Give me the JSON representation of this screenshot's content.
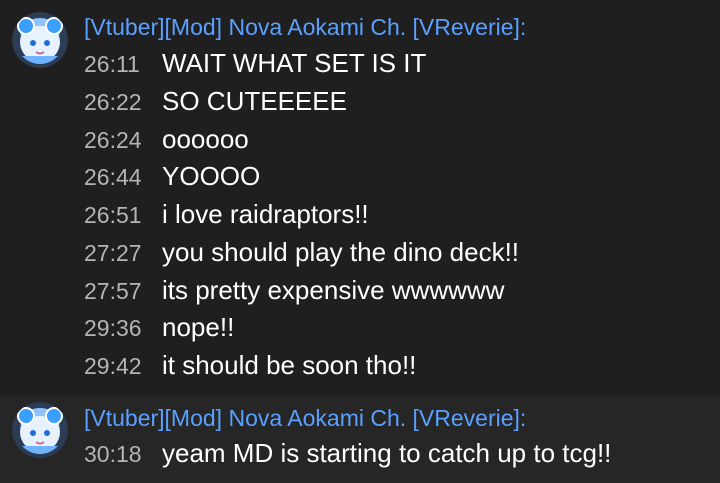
{
  "messages": [
    {
      "author": "[Vtuber][Mod] Nova Aokami Ch. [VReverie]:",
      "lines": [
        {
          "time": "26:11",
          "text": "WAIT WHAT SET IS IT"
        },
        {
          "time": "26:22",
          "text": "SO CUTEEEEE"
        },
        {
          "time": "26:24",
          "text": "oooooo"
        },
        {
          "time": "26:44",
          "text": "YOOOO"
        },
        {
          "time": "26:51",
          "text": "i love raidraptors!!"
        },
        {
          "time": "27:27",
          "text": "you should play the dino deck!!"
        },
        {
          "time": "27:57",
          "text": "its pretty expensive wwwwww"
        },
        {
          "time": "29:36",
          "text": "nope!!"
        },
        {
          "time": "29:42",
          "text": "it should be soon tho!!"
        }
      ]
    },
    {
      "author": "[Vtuber][Mod] Nova Aokami Ch. [VReverie]:",
      "lines": [
        {
          "time": "30:18",
          "text": "yeam MD is starting to catch up to tcg!!"
        }
      ]
    }
  ],
  "colors": {
    "background": "#1f1f1f",
    "author": "#5aa0ff",
    "timestamp": "#b4b4b4",
    "message": "#ffffff"
  },
  "icons": {
    "avatar": "avatar-icon"
  }
}
